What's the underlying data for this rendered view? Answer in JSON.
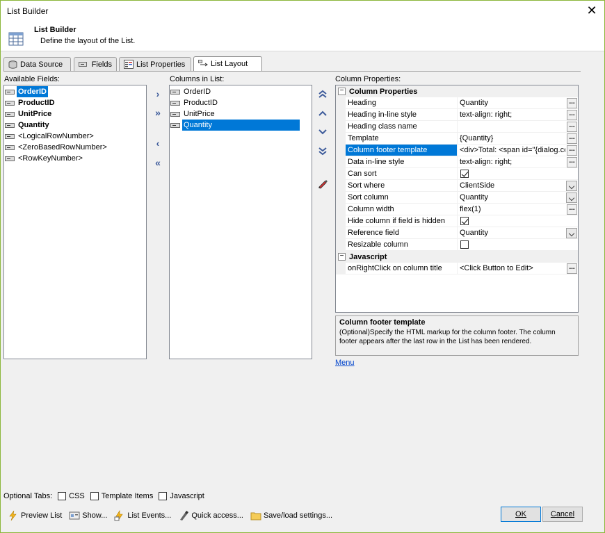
{
  "window": {
    "title": "List Builder"
  },
  "header": {
    "title": "List Builder",
    "subtitle": "Define the layout of the List."
  },
  "tabs": [
    {
      "label": "Data Source",
      "icon": "database-icon"
    },
    {
      "label": "Fields",
      "icon": "field-icon"
    },
    {
      "label": "List Properties",
      "icon": "properties-icon"
    },
    {
      "label": "List Layout",
      "icon": "layout-icon",
      "active": true
    }
  ],
  "available_fields": {
    "label": "Available Fields:",
    "items": [
      {
        "text": "OrderID",
        "bold": true,
        "selected": true
      },
      {
        "text": "ProductID",
        "bold": true
      },
      {
        "text": "UnitPrice",
        "bold": true
      },
      {
        "text": "Quantity",
        "bold": true
      },
      {
        "text": "<LogicalRowNumber>"
      },
      {
        "text": "<ZeroBasedRowNumber>"
      },
      {
        "text": "<RowKeyNumber>"
      }
    ]
  },
  "columns_in_list": {
    "label": "Columns in List:",
    "items": [
      {
        "text": "OrderID"
      },
      {
        "text": "ProductID"
      },
      {
        "text": "UnitPrice"
      },
      {
        "text": "Quantity",
        "selected": true
      }
    ]
  },
  "move_buttons": {
    "add": "›",
    "add_all": "»",
    "remove": "‹",
    "remove_all": "«"
  },
  "order_buttons": {
    "top": "⌃⌃",
    "up": "⌃",
    "down": "⌄",
    "bottom": "⌄⌄"
  },
  "column_properties": {
    "label": "Column Properties:",
    "categories": [
      {
        "name": "Column Properties",
        "rows": [
          {
            "name": "Heading",
            "value": "Quantity",
            "editor": "ellipsis"
          },
          {
            "name": "Heading in-line style",
            "value": "text-align: right;",
            "editor": "ellipsis"
          },
          {
            "name": "Heading class name",
            "value": "",
            "editor": "ellipsis"
          },
          {
            "name": "Template",
            "value": "{Quantity}",
            "editor": "ellipsis"
          },
          {
            "name": "Column footer template",
            "value": "<div>Total: <span id=\"{dialog.cc",
            "editor": "ellipsis",
            "selected": true
          },
          {
            "name": "Data in-line style",
            "value": "text-align: right;",
            "editor": "ellipsis"
          },
          {
            "name": "Can sort",
            "value": "",
            "editor": "checkbox",
            "checked": true
          },
          {
            "name": "Sort where",
            "value": "ClientSide",
            "editor": "dropdown"
          },
          {
            "name": "Sort column",
            "value": "Quantity",
            "editor": "dropdown"
          },
          {
            "name": "Column width",
            "value": "flex(1)",
            "editor": "ellipsis"
          },
          {
            "name": "Hide column if field is hidden",
            "value": "",
            "editor": "checkbox",
            "checked": true
          },
          {
            "name": "Reference field",
            "value": "Quantity",
            "editor": "dropdown"
          },
          {
            "name": "Resizable column",
            "value": "",
            "editor": "checkbox",
            "checked": false
          }
        ]
      },
      {
        "name": "Javascript",
        "rows": [
          {
            "name": "onRightClick on column title",
            "value": "<Click Button to Edit>",
            "editor": "ellipsis"
          }
        ]
      }
    ]
  },
  "description": {
    "title": "Column footer template",
    "text": "(Optional)Specify the HTML markup for the column footer. The column footer appears after the last row in the List has been rendered."
  },
  "menu_link": "Menu",
  "optional_tabs": {
    "label": "Optional Tabs:",
    "options": [
      {
        "label": "CSS",
        "checked": false
      },
      {
        "label": "Template Items",
        "checked": false
      },
      {
        "label": "Javascript",
        "checked": false
      }
    ]
  },
  "bottom_actions": [
    {
      "label": "Preview List",
      "icon": "lightning-icon"
    },
    {
      "label": "Show...",
      "icon": "show-icon"
    },
    {
      "label": "List Events...",
      "icon": "events-icon"
    },
    {
      "label": "Quick access...",
      "icon": "quick-access-icon"
    },
    {
      "label": "Save/load settings...",
      "icon": "folder-icon"
    }
  ],
  "buttons": {
    "ok": "OK",
    "cancel": "Cancel"
  },
  "ellipsis": "..."
}
